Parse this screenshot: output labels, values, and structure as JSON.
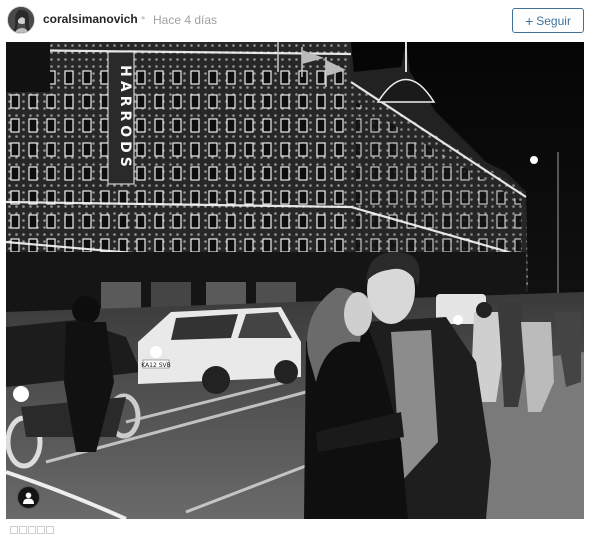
{
  "post": {
    "username": "coralsimanovich",
    "separator": "•",
    "time": "Hace 4 días",
    "follow_button": {
      "icon": "plus-icon",
      "label": "Seguir"
    }
  },
  "photo": {
    "sign_text": "HARRODS",
    "plate_text": "KA12 SVB",
    "user_tag_icon": "person-icon"
  },
  "footer": {
    "icons": [
      "box-icon",
      "box-icon",
      "box-icon",
      "box-icon",
      "box-icon"
    ]
  },
  "colors": {
    "accent": "#3f729b",
    "username": "#262626",
    "muted": "#a0a0a0"
  }
}
